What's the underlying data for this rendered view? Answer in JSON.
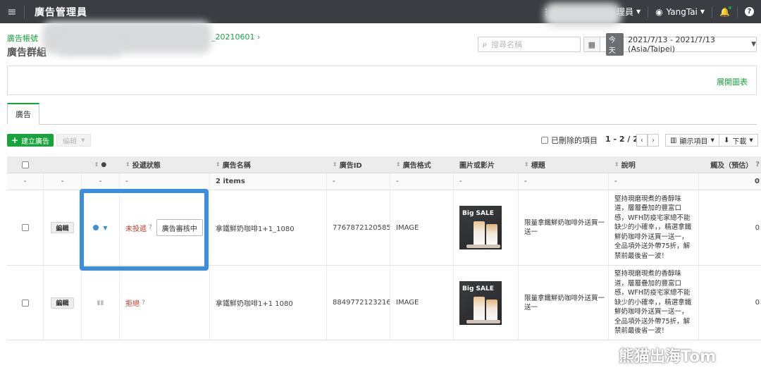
{
  "topbar": {
    "app_title": "廣告管理員",
    "account_menu_fragment": "理員",
    "user_name": "YangTai",
    "help_label": "?"
  },
  "breadcrumb": {
    "account_label": "廣告帳號",
    "campaign_fragment": "_20210601",
    "group_title_fragment": "廣告群組"
  },
  "search": {
    "placeholder": "搜尋名稱"
  },
  "date": {
    "today_label": "今天",
    "range": "2021/7/13 - 2021/7/13 (Asia/Taipei)"
  },
  "chart_panel": {
    "expand_label": "展開圖表"
  },
  "tabs": [
    {
      "label": "廣告"
    }
  ],
  "toolbar": {
    "create_label": "建立廣告",
    "edit_label": "編輯",
    "deleted_label": "已刪除的項目",
    "pager": "1 - 2 / 2",
    "display_label": "顯示項目",
    "download_label": "下載"
  },
  "table": {
    "headers": {
      "status": "投遞狀態",
      "name": "廣告名稱",
      "id": "廣告ID",
      "format": "廣告格式",
      "media": "圖片或影片",
      "title": "標題",
      "description": "說明",
      "reach": "觸及（預估）"
    },
    "summary": {
      "dash": "-",
      "items": "2 items",
      "reach": "0"
    },
    "rows": [
      {
        "edit_label": "編輯",
        "status": "未投遞",
        "review_label": "廣告審核中",
        "name": "拿鐵鮮奶咖啡1+1_1080",
        "id": "7767872120585",
        "format": "IMAGE",
        "title": "限量拿鐵鮮奶咖啡外送買一送一",
        "description": "堅持現磨現煮的香醇味道，層層疊加的豐富口感，WFH防疫宅家總不能缺少的小確幸，，精選拿鐵鮮奶咖啡外送買一送一，全品項外送外帶75折，解禁前最後省一波！",
        "reach": "0",
        "thumb_text": "Big SALE"
      },
      {
        "edit_label": "編輯",
        "status": "拒絕",
        "review_label": "",
        "name": "拿鐵鮮奶咖啡1+1 1080",
        "id": "8849772123216",
        "format": "IMAGE",
        "title": "限量拿鐵鮮奶咖啡外送買一送一",
        "description": "堅持現磨現煮的香醇味道，層層疊加的豐富口感，WFH防疫宅家總不能缺少的小確幸，，精選拿鐵鮮奶咖啡外送買一送一，全品項外送外帶75折，解禁前最後省一波！",
        "reach": "0",
        "thumb_text": "Big SALE"
      }
    ]
  },
  "watermark": {
    "text": "熊猫出海Tom"
  },
  "colors": {
    "accent_green": "#19a33d",
    "topbar": "#3a3d42",
    "highlight_blue": "#3b8ede",
    "status_red": "#c0392b"
  }
}
